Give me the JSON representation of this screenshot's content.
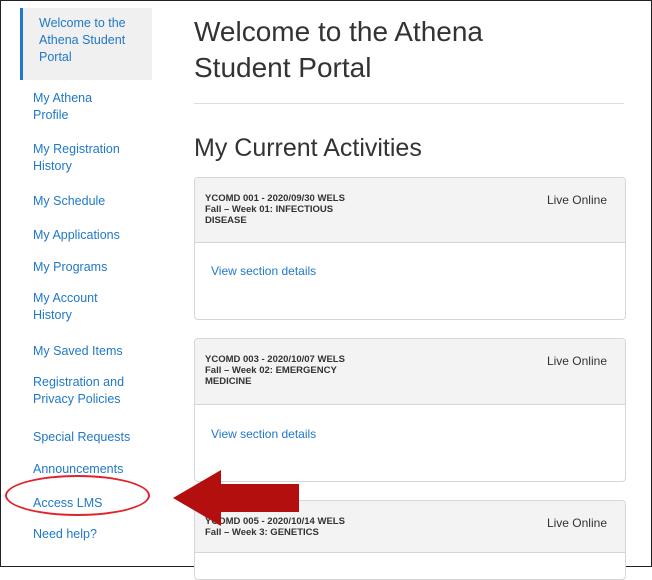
{
  "sidebar": {
    "items": [
      {
        "line1": "Welcome to the",
        "line2": "Athena Student",
        "line3": "Portal"
      },
      {
        "line1": "My Athena",
        "line2": "Profile"
      },
      {
        "line1": "My Registration",
        "line2": "History"
      },
      {
        "line1": "My Schedule"
      },
      {
        "line1": "My Applications"
      },
      {
        "line1": "My Programs"
      },
      {
        "line1": "My Account",
        "line2": "History"
      },
      {
        "line1": "My Saved Items"
      },
      {
        "line1": "Registration and",
        "line2": "Privacy Policies"
      },
      {
        "line1": "Special Requests"
      },
      {
        "line1": "Announcements"
      },
      {
        "line1": "Access LMS"
      },
      {
        "line1": "Need help?"
      }
    ]
  },
  "main": {
    "title_line1": "Welcome to the Athena",
    "title_line2": "Student Portal",
    "section_title": "My Current Activities",
    "cards": [
      {
        "title_line1": "YCOMD 001 - 2020/09/30 WELS",
        "title_line2": "Fall – Week 01: INFECTIOUS",
        "title_line3": "DISEASE",
        "mode": "Live Online",
        "link": "View section details"
      },
      {
        "title_line1": "YCOMD 003 - 2020/10/07 WELS",
        "title_line2": "Fall – Week 02: EMERGENCY",
        "title_line3": "MEDICINE",
        "mode": "Live Online",
        "link": "View section details"
      },
      {
        "title_line1": "YCOMD 005 - 2020/10/14 WELS",
        "title_line2": "Fall – Week 3: GENETICS",
        "title_line3": "",
        "mode": "Live Online",
        "link": ""
      }
    ]
  },
  "colors": {
    "link": "#1f78c8",
    "annotation": "#e0242c",
    "arrow": "#b30f0f"
  }
}
